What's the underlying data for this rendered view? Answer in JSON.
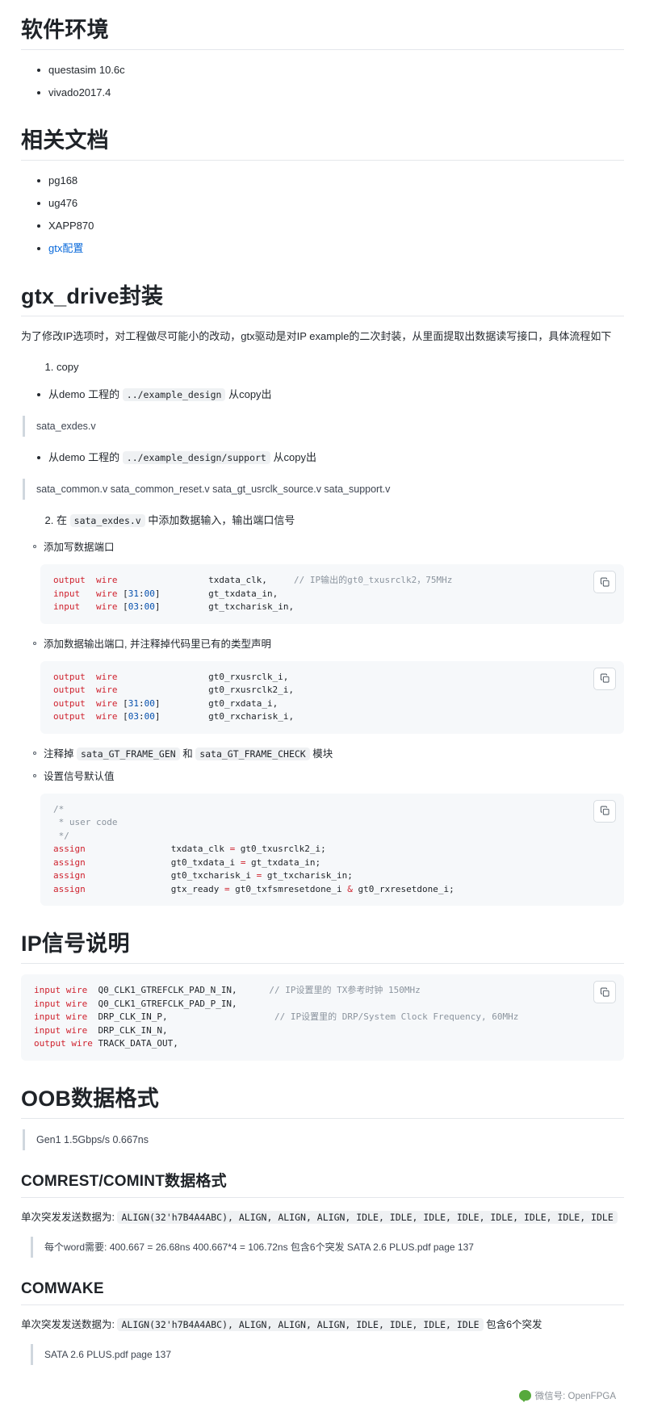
{
  "sections": {
    "software_env": {
      "title": "软件环境",
      "items": [
        "questasim 10.6c",
        "vivado2017.4"
      ]
    },
    "related_docs": {
      "title": "相关文档",
      "items": [
        "pg168",
        "ug476",
        "XAPP870"
      ],
      "link": "gtx配置"
    },
    "gtx_drive": {
      "title": "gtx_drive封装",
      "paragraph": "为了修改IP选项时，对工程做尽可能小的改动，gtx驱动是对IP example的二次封装，从里面提取出数据读写接口，具体流程如下",
      "step1_label": "copy",
      "bullet1_prefix": "从demo 工程的",
      "bullet1_code": "../example_design",
      "bullet1_suffix": "从copy出",
      "quote1": "sata_exdes.v",
      "bullet2_prefix": "从demo 工程的",
      "bullet2_code": "../example_design/support",
      "bullet2_suffix": "从copy出",
      "quote2": "sata_common.v sata_common_reset.v sata_gt_usrclk_source.v sata_support.v",
      "step2_prefix": "在",
      "step2_code": "sata_exdes.v",
      "step2_suffix": "中添加数据输入，输出端口信号",
      "sub1": "添加写数据端口",
      "sub2": "添加数据输出端口, 并注释掉代码里已有的类型声明",
      "sub3_prefix": "注释掉",
      "sub3_code1": "sata_GT_FRAME_GEN",
      "sub3_mid": "和",
      "sub3_code2": "sata_GT_FRAME_CHECK",
      "sub3_suffix": "模块",
      "sub4": "设置信号默认值",
      "code1": "output  wire                 txdata_clk,     // IP输出的gt0_txusrclk2，75MHz\ninput   wire [31:00]         gt_txdata_in,\ninput   wire [03:00]         gt_txcharisk_in,",
      "code2": "output  wire                 gt0_rxusrclk_i,\noutput  wire                 gt0_rxusrclk2_i,\noutput  wire [31:00]         gt0_rxdata_i,\noutput  wire [03:00]         gt0_rxcharisk_i,",
      "code3": "/*\n * user code\n */\nassign                txdata_clk = gt0_txusrclk2_i;\nassign                gt0_txdata_i = gt_txdata_in;\nassign                gt0_txcharisk_i = gt_txcharisk_in;\nassign                gtx_ready = gt0_txfsmresetdone_i & gt0_rxresetdone_i;"
    },
    "ip_signals": {
      "title": "IP信号说明",
      "code": "input wire  Q0_CLK1_GTREFCLK_PAD_N_IN,      // IP设置里的 TX参考时钟 150MHz\ninput wire  Q0_CLK1_GTREFCLK_PAD_P_IN,\ninput wire  DRP_CLK_IN_P,                    // IP设置里的 DRP/System Clock Frequency, 60MHz\ninput wire  DRP_CLK_IN_N,\noutput wire TRACK_DATA_OUT,"
    },
    "oob": {
      "title": "OOB数据格式",
      "quote": "Gen1 1.5Gbps/s 0.667ns"
    },
    "comrest": {
      "title": "COMREST/COMINT数据格式",
      "line_prefix": "单次突发发送数据为:",
      "line_code": "ALIGN(32'h7B4A4ABC), ALIGN, ALIGN, ALIGN, IDLE, IDLE, IDLE, IDLE, IDLE, IDLE, IDLE, IDLE",
      "quote_a": "每个word需要:",
      "quote_b": "400.667 = 26.68ns",
      "quote_c": "400.667*4 = 106.72ns 包含6个突发 SATA 2.6 PLUS.pdf page 137"
    },
    "comwake": {
      "title": "COMWAKE",
      "line_prefix": "单次突发发送数据为:",
      "line_code": "ALIGN(32'h7B4A4ABC), ALIGN, ALIGN, ALIGN, IDLE, IDLE, IDLE, IDLE",
      "line_suffix": "包含6个突发",
      "note": "SATA 2.6 PLUS.pdf page 137"
    }
  },
  "icons": {
    "copy": "copy-icon"
  },
  "watermark": {
    "text": "微信号: OpenFPGA"
  },
  "colors": {
    "link": "#0969da",
    "code_bg": "#f6f8fa",
    "inline_code_bg": "#eff1f3",
    "keyword": "#cf222e",
    "comment": "#8b949e",
    "number": "#0550ae",
    "text": "#24292f"
  }
}
